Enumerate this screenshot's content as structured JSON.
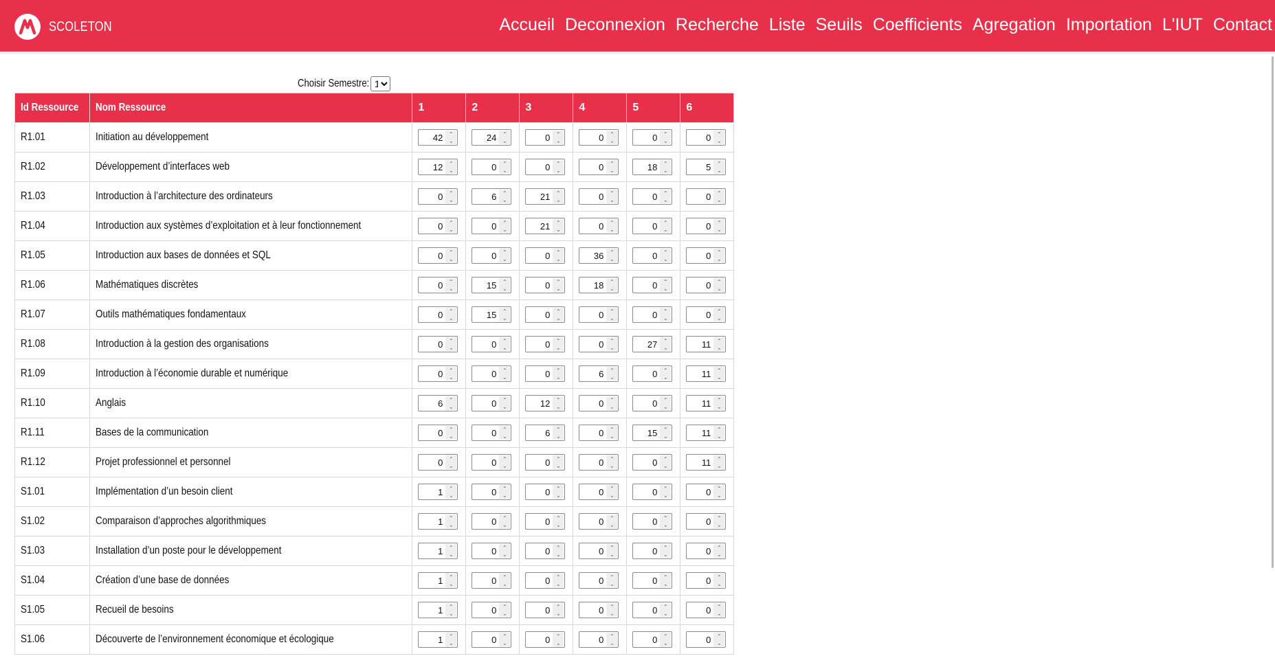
{
  "brand": {
    "name": "SCOLETON"
  },
  "nav": [
    "Accueil",
    "Deconnexion",
    "Recherche",
    "Liste",
    "Seuils",
    "Coefficients",
    "Agregation",
    "Importation",
    "L'IUT",
    "Contact"
  ],
  "semester": {
    "label": "Choisir Semestre:",
    "value": "1"
  },
  "table": {
    "headers": [
      "Id Ressource",
      "Nom Ressource",
      "1",
      "2",
      "3",
      "4",
      "5",
      "6"
    ],
    "rows": [
      {
        "id": "R1.01",
        "name": "Initiation au développement",
        "values": [
          "42",
          "24",
          "0",
          "0",
          "0",
          "0"
        ]
      },
      {
        "id": "R1.02",
        "name": "Développement d’interfaces web",
        "values": [
          "12",
          "0",
          "0",
          "0",
          "18",
          "5"
        ]
      },
      {
        "id": "R1.03",
        "name": "Introduction à l’architecture des ordinateurs",
        "values": [
          "0",
          "6",
          "21",
          "0",
          "0",
          "0"
        ]
      },
      {
        "id": "R1.04",
        "name": "Introduction aux systèmes d’exploitation et à leur fonctionnement",
        "values": [
          "0",
          "0",
          "21",
          "0",
          "0",
          "0"
        ]
      },
      {
        "id": "R1.05",
        "name": "Introduction aux bases de données et SQL",
        "values": [
          "0",
          "0",
          "0",
          "36",
          "0",
          "0"
        ]
      },
      {
        "id": "R1.06",
        "name": "Mathématiques discrètes",
        "values": [
          "0",
          "15",
          "0",
          "18",
          "0",
          "0"
        ]
      },
      {
        "id": "R1.07",
        "name": "Outils mathématiques fondamentaux",
        "values": [
          "0",
          "15",
          "0",
          "0",
          "0",
          "0"
        ]
      },
      {
        "id": "R1.08",
        "name": "Introduction à la gestion des organisations",
        "values": [
          "0",
          "0",
          "0",
          "0",
          "27",
          "11"
        ]
      },
      {
        "id": "R1.09",
        "name": "Introduction à l’économie durable et numérique",
        "values": [
          "0",
          "0",
          "0",
          "6",
          "0",
          "11"
        ]
      },
      {
        "id": "R1.10",
        "name": "Anglais",
        "values": [
          "6",
          "0",
          "12",
          "0",
          "0",
          "11"
        ]
      },
      {
        "id": "R1.11",
        "name": "Bases de la communication",
        "values": [
          "0",
          "0",
          "6",
          "0",
          "15",
          "11"
        ]
      },
      {
        "id": "R1.12",
        "name": "Projet professionnel et personnel",
        "values": [
          "0",
          "0",
          "0",
          "0",
          "0",
          "11"
        ]
      },
      {
        "id": "S1.01",
        "name": "Implémentation d’un besoin client",
        "values": [
          "1",
          "0",
          "0",
          "0",
          "0",
          "0"
        ]
      },
      {
        "id": "S1.02",
        "name": "Comparaison d’approches algorithmiques",
        "values": [
          "1",
          "0",
          "0",
          "0",
          "0",
          "0"
        ]
      },
      {
        "id": "S1.03",
        "name": "Installation d’un poste pour le développement",
        "values": [
          "1",
          "0",
          "0",
          "0",
          "0",
          "0"
        ]
      },
      {
        "id": "S1.04",
        "name": "Création d’une base de données",
        "values": [
          "1",
          "0",
          "0",
          "0",
          "0",
          "0"
        ]
      },
      {
        "id": "S1.05",
        "name": "Recueil de besoins",
        "values": [
          "1",
          "0",
          "0",
          "0",
          "0",
          "0"
        ]
      },
      {
        "id": "S1.06",
        "name": "Découverte de l’environnement économique et écologique",
        "values": [
          "1",
          "0",
          "0",
          "0",
          "0",
          "0"
        ]
      }
    ]
  },
  "colors": {
    "accent": "#e8304a",
    "border": "#d8d8d8"
  },
  "icons": {
    "logo": "scoleton-logo-icon",
    "spinner": "spinner-arrows-icon"
  }
}
